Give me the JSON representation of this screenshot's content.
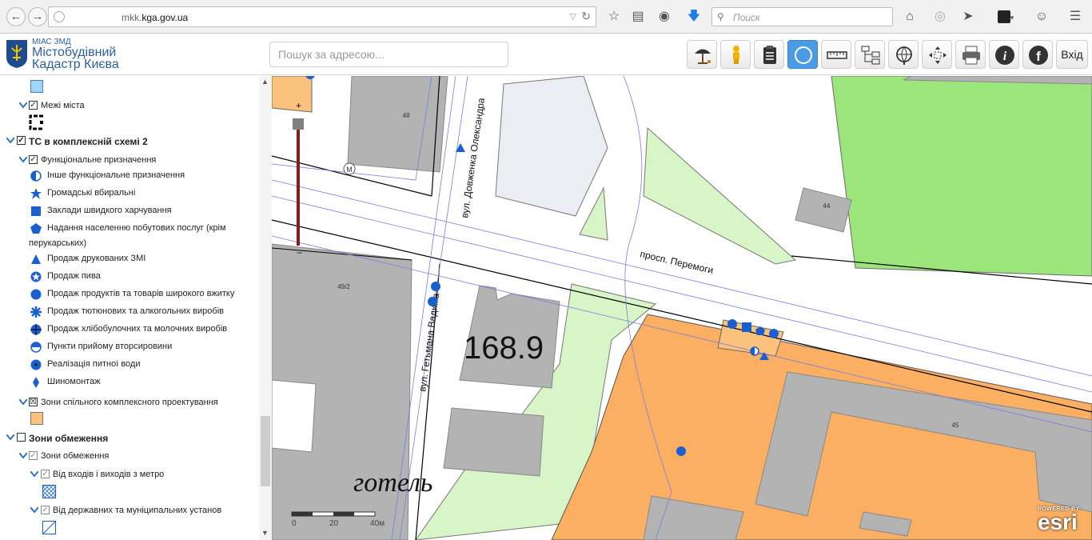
{
  "browser": {
    "url_prefix": "mkk.",
    "url_domain": "kga.gov.ua",
    "search_placeholder": "Поиск"
  },
  "header": {
    "logo_small": "МІАС ЗМД",
    "logo_line1": "Містобудівний",
    "logo_line2": "Кадастр Києва",
    "address_placeholder": "Пошук за адресою...",
    "login_label": "Вхід"
  },
  "layers": {
    "city_limits": "Межі міста",
    "ts_group": "ТС в комплексній схемі 2",
    "functional": "Функціональне призначення",
    "items": [
      "Інше функціональне призначення",
      "Громадські вбиральні",
      "Заклади швидкого харчування",
      "Надання населенню побутових послуг (крім",
      "перукарських)",
      "Продаж друкованих ЗМІ",
      "Продаж пива",
      "Продаж продуктів та товарів широкого вжитку",
      "Продаж тютюнових та алкогольних виробів",
      "Продаж хлібобулочних та молочних виробів",
      "Пункти прийому вторсировини",
      "Реалізація питної води",
      "Шиномонтаж"
    ],
    "joint_zones": "Зони спільного комплексного проектування",
    "restriction_group": "Зони обмеження",
    "restriction_sub": "Зони обмеження",
    "metro_exits": "Від входів і виходів з метро",
    "state_institutions": "Від державних та муніципальних установ"
  },
  "map": {
    "street_1": "вул. Довженка Олександра",
    "street_2": "просп. Перемоги",
    "street_3": "вул. Гетьмана Вадима",
    "building_48": "48",
    "building_44": "44",
    "building_49_2": "49/2",
    "building_45": "45",
    "metro_symbol": "M",
    "big_number": "168.9",
    "hotel_label": "готель",
    "scale_0": "0",
    "scale_20": "20",
    "scale_40": "40м",
    "zoom_plus": "+",
    "zoom_minus": "−",
    "esri_powered": "POWERED BY",
    "esri_logo": "esri"
  },
  "colors": {
    "accent_blue": "#1a5fd0",
    "orange_zone": "#fbaf63",
    "green_park": "#9be57c",
    "light_green": "#d7f5c6",
    "building_grey": "#b3b3b3",
    "active_tool": "#4a9be4"
  }
}
